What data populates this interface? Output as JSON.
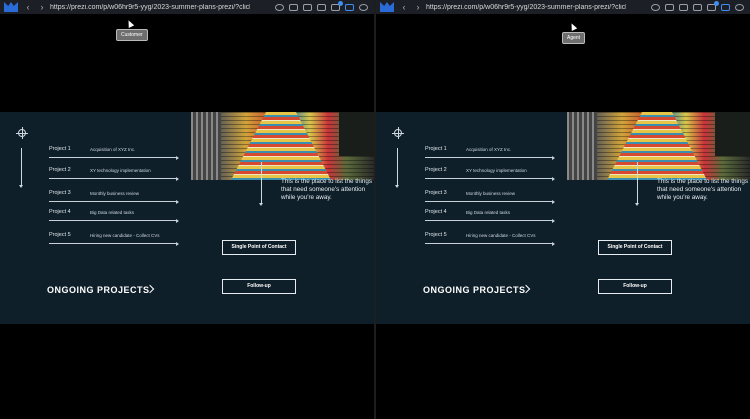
{
  "browser": {
    "url": "https://prezi.com/p/w06hr9r5-yyg/2023-summer-plans-prezi/?click_sourc...",
    "back_label": "‹",
    "forward_label": "›"
  },
  "views": [
    {
      "role": "Customer"
    },
    {
      "role": "Agent"
    }
  ],
  "slide": {
    "projects": [
      {
        "name": "Project 1",
        "desc": "Acquisition of XYZ Inc."
      },
      {
        "name": "Project 2",
        "desc": "XY technology implementation"
      },
      {
        "name": "Project 3",
        "desc": "Monthly business review"
      },
      {
        "name": "Project 4",
        "desc": "Big Data related tasks"
      },
      {
        "name": "Project 5",
        "desc": "Hiring new candidate - Collect CVs"
      }
    ],
    "heading": "ONGOING PROJECTS",
    "note": "This is the place to list the things that need someone's attention while you're away.",
    "buttons": {
      "contact": "Single Point of Contact",
      "followup": "Follow-up"
    }
  },
  "colors": {
    "slide_bg": "#0f1f2a",
    "accent": "#3f8ef0"
  }
}
